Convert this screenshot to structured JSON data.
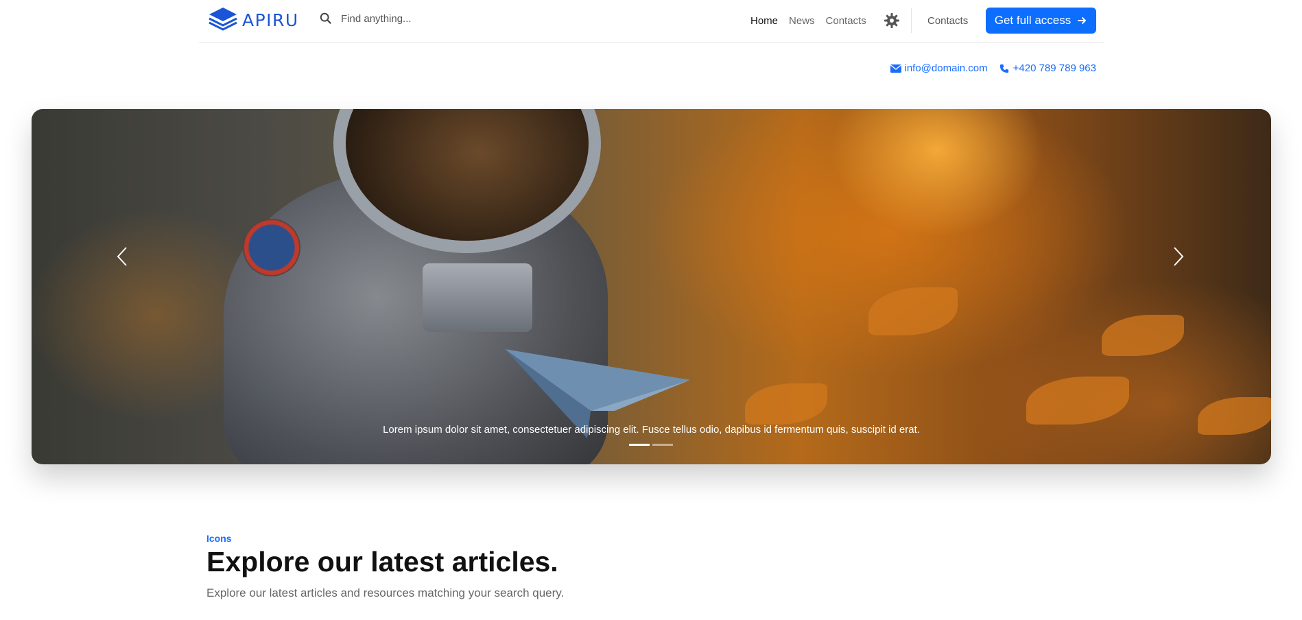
{
  "header": {
    "logo_text": "APIRU",
    "search_placeholder": "Find anything...",
    "nav": [
      "Home",
      "News",
      "Contacts"
    ],
    "secondary_link": "Contacts",
    "cta_label": "Get full access",
    "icons": {
      "logo": "layers-icon",
      "search": "search-icon",
      "theme": "gear-icon",
      "cta": "arrow-right-icon"
    }
  },
  "contact": {
    "email": "info@domain.com",
    "phone": "+420 789 789 963",
    "icons": {
      "email": "envelope-icon",
      "phone": "phone-icon"
    }
  },
  "hero": {
    "caption": "Lorem ipsum dolor sit amet, consectetuer adipiscing elit. Fusce tellus odio, dapibus id fermentum quis, suscipit id erat.",
    "slide_count": 2,
    "active_slide": 0,
    "icons": {
      "prev": "chevron-left-icon",
      "next": "chevron-right-icon"
    }
  },
  "section": {
    "kicker": "Icons",
    "title": "Explore our latest articles.",
    "subtitle": "Explore our latest articles and resources matching your search query."
  },
  "colors": {
    "accent": "#0d6efd",
    "logo": "#1a55d8",
    "link": "#1a6dfd"
  }
}
